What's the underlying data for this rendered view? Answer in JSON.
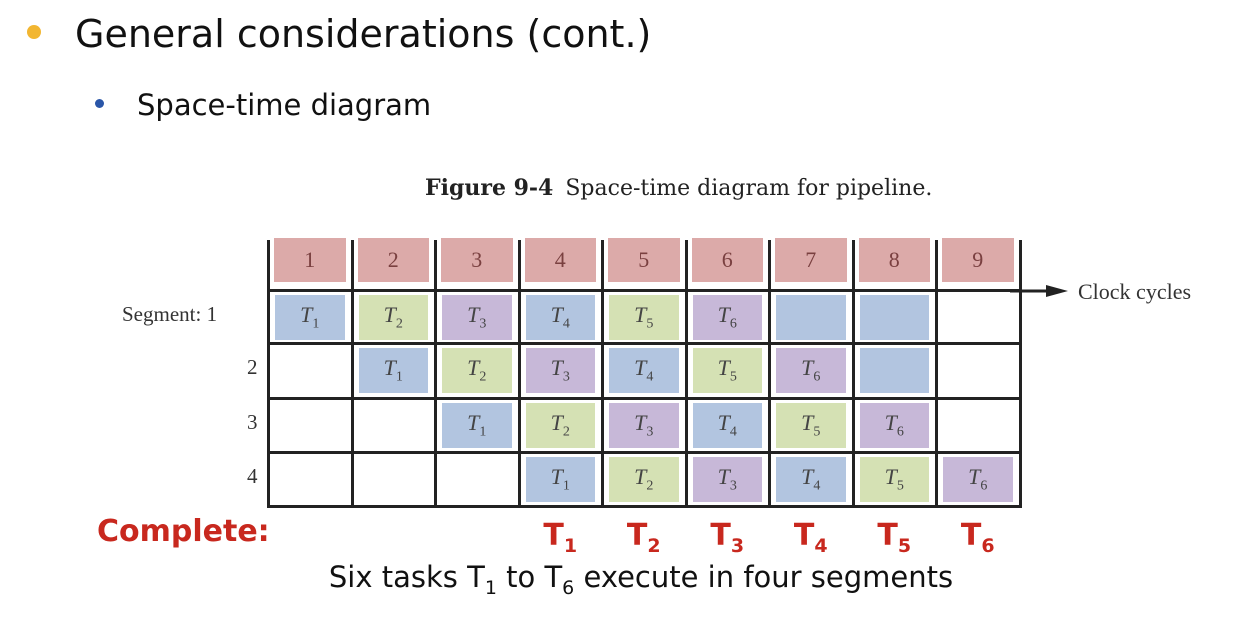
{
  "slide": {
    "title": "General considerations (cont.)",
    "bullet": "Space-time diagram",
    "figure_label": "Figure 9-4",
    "figure_caption": "Space-time diagram for pipeline.",
    "segment_prefix": "Segment:",
    "axis_label": "Clock cycles",
    "complete_label": "Complete:",
    "completed_tasks": [
      "1",
      "2",
      "3",
      "4",
      "5",
      "6"
    ],
    "completed_columns": [
      4,
      5,
      6,
      7,
      8,
      9
    ],
    "caption_parts": [
      "Six tasks T",
      "1",
      " to T",
      "6",
      " execute in four segments"
    ]
  },
  "colors": {
    "header": "#dcaaa9",
    "blue": "#b2c5e0",
    "green": "#d5e1b4",
    "purple": "#c7b8d8",
    "complete": "#c8281e",
    "bullet1": "#f2b631",
    "bullet2": "#2a56a8"
  },
  "diagram": {
    "clock_cycles": [
      "1",
      "2",
      "3",
      "4",
      "5",
      "6",
      "7",
      "8",
      "9"
    ],
    "segments": [
      "1",
      "2",
      "3",
      "4"
    ],
    "rows": [
      [
        {
          "t": "1",
          "c": "blue"
        },
        {
          "t": "2",
          "c": "green"
        },
        {
          "t": "3",
          "c": "purple"
        },
        {
          "t": "4",
          "c": "blue"
        },
        {
          "t": "5",
          "c": "green"
        },
        {
          "t": "6",
          "c": "purple"
        },
        {
          "t": "",
          "c": "blue"
        },
        {
          "t": "",
          "c": "blue"
        },
        {
          "t": "",
          "c": ""
        }
      ],
      [
        {
          "t": "",
          "c": ""
        },
        {
          "t": "1",
          "c": "blue"
        },
        {
          "t": "2",
          "c": "green"
        },
        {
          "t": "3",
          "c": "purple"
        },
        {
          "t": "4",
          "c": "blue"
        },
        {
          "t": "5",
          "c": "green"
        },
        {
          "t": "6",
          "c": "purple"
        },
        {
          "t": "",
          "c": "blue"
        },
        {
          "t": "",
          "c": ""
        }
      ],
      [
        {
          "t": "",
          "c": ""
        },
        {
          "t": "",
          "c": ""
        },
        {
          "t": "1",
          "c": "blue"
        },
        {
          "t": "2",
          "c": "green"
        },
        {
          "t": "3",
          "c": "purple"
        },
        {
          "t": "4",
          "c": "blue"
        },
        {
          "t": "5",
          "c": "green"
        },
        {
          "t": "6",
          "c": "purple"
        },
        {
          "t": "",
          "c": ""
        }
      ],
      [
        {
          "t": "",
          "c": ""
        },
        {
          "t": "",
          "c": ""
        },
        {
          "t": "",
          "c": ""
        },
        {
          "t": "1",
          "c": "blue"
        },
        {
          "t": "2",
          "c": "green"
        },
        {
          "t": "3",
          "c": "purple"
        },
        {
          "t": "4",
          "c": "blue"
        },
        {
          "t": "5",
          "c": "green"
        },
        {
          "t": "6",
          "c": "purple"
        }
      ]
    ]
  }
}
